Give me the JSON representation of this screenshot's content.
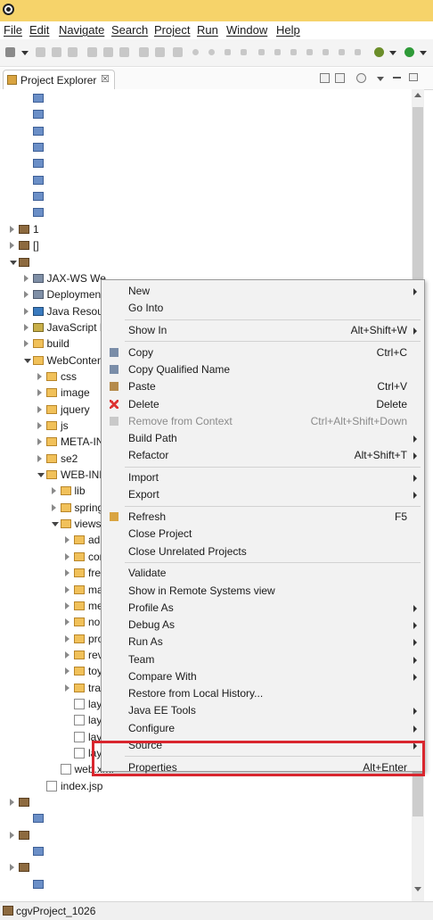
{
  "menubar": {
    "items": [
      "File",
      "Edit",
      "Navigate",
      "Search",
      "Project",
      "Run",
      "Window",
      "Help"
    ]
  },
  "view_tab": {
    "title": "Project Explorer",
    "close": "☒"
  },
  "tree": [
    {
      "depth": 1,
      "icon": "pkg",
      "label": "",
      "tw": "none"
    },
    {
      "depth": 1,
      "icon": "pkg",
      "label": "",
      "tw": "none"
    },
    {
      "depth": 1,
      "icon": "pkg",
      "label": "",
      "tw": "none"
    },
    {
      "depth": 1,
      "icon": "pkg",
      "label": "",
      "tw": "none"
    },
    {
      "depth": 1,
      "icon": "pkg",
      "label": "",
      "tw": "none"
    },
    {
      "depth": 1,
      "icon": "pkg",
      "label": "",
      "tw": "none"
    },
    {
      "depth": 1,
      "icon": "pkg",
      "label": "",
      "tw": "none"
    },
    {
      "depth": 1,
      "icon": "pkg",
      "label": "",
      "tw": "none"
    },
    {
      "depth": 0,
      "icon": "proj",
      "label": "1",
      "tw": "c"
    },
    {
      "depth": 0,
      "icon": "proj",
      "label": "[]",
      "tw": "c"
    },
    {
      "depth": 0,
      "icon": "proj",
      "label": "",
      "tw": "e"
    },
    {
      "depth": 1,
      "icon": "tool",
      "label": "JAX-WS We",
      "tw": "c"
    },
    {
      "depth": 1,
      "icon": "tool",
      "label": "Deploymen",
      "tw": "c"
    },
    {
      "depth": 1,
      "icon": "db",
      "label": "Java Resour",
      "tw": "c"
    },
    {
      "depth": 1,
      "icon": "js",
      "label": "JavaScript R",
      "tw": "c"
    },
    {
      "depth": 1,
      "icon": "fold",
      "label": "build",
      "tw": "c"
    },
    {
      "depth": 1,
      "icon": "fold",
      "label": "WebConten",
      "tw": "e"
    },
    {
      "depth": 2,
      "icon": "fold",
      "label": "css",
      "tw": "c"
    },
    {
      "depth": 2,
      "icon": "fold",
      "label": "image",
      "tw": "c"
    },
    {
      "depth": 2,
      "icon": "fold",
      "label": "jquery",
      "tw": "c"
    },
    {
      "depth": 2,
      "icon": "fold",
      "label": "js",
      "tw": "c"
    },
    {
      "depth": 2,
      "icon": "fold",
      "label": "META-IN",
      "tw": "c"
    },
    {
      "depth": 2,
      "icon": "fold",
      "label": "se2",
      "tw": "c"
    },
    {
      "depth": 2,
      "icon": "fold",
      "label": "WEB-INF",
      "tw": "e"
    },
    {
      "depth": 3,
      "icon": "fold",
      "label": "lib",
      "tw": "c"
    },
    {
      "depth": 3,
      "icon": "fold",
      "label": "spring",
      "tw": "c"
    },
    {
      "depth": 3,
      "icon": "fold",
      "label": "views",
      "tw": "e"
    },
    {
      "depth": 4,
      "icon": "fold",
      "label": "adi",
      "tw": "c"
    },
    {
      "depth": 4,
      "icon": "fold",
      "label": "cor",
      "tw": "c"
    },
    {
      "depth": 4,
      "icon": "fold",
      "label": "fre",
      "tw": "c"
    },
    {
      "depth": 4,
      "icon": "fold",
      "label": "ma",
      "tw": "c"
    },
    {
      "depth": 4,
      "icon": "fold",
      "label": "me",
      "tw": "c"
    },
    {
      "depth": 4,
      "icon": "fold",
      "label": "no",
      "tw": "c"
    },
    {
      "depth": 4,
      "icon": "fold",
      "label": "pro",
      "tw": "c"
    },
    {
      "depth": 4,
      "icon": "fold",
      "label": "rev",
      "tw": "c"
    },
    {
      "depth": 4,
      "icon": "fold",
      "label": "toy",
      "tw": "c"
    },
    {
      "depth": 4,
      "icon": "fold",
      "label": "tra",
      "tw": "c"
    },
    {
      "depth": 4,
      "icon": "file",
      "label": "lay",
      "tw": "none"
    },
    {
      "depth": 4,
      "icon": "file",
      "label": "lay",
      "tw": "none"
    },
    {
      "depth": 4,
      "icon": "file",
      "label": "lay",
      "tw": "none"
    },
    {
      "depth": 4,
      "icon": "file",
      "label": "layouts.xml",
      "tw": "none"
    },
    {
      "depth": 3,
      "icon": "file",
      "label": "web.xml",
      "tw": "none"
    },
    {
      "depth": 2,
      "icon": "file",
      "label": "index.jsp",
      "tw": "none"
    },
    {
      "depth": 0,
      "icon": "proj",
      "label": "",
      "tw": "c"
    },
    {
      "depth": 1,
      "icon": "pkg",
      "label": "",
      "tw": "none"
    },
    {
      "depth": 0,
      "icon": "proj",
      "label": "",
      "tw": "c"
    },
    {
      "depth": 1,
      "icon": "pkg",
      "label": "",
      "tw": "none"
    },
    {
      "depth": 0,
      "icon": "proj",
      "label": "",
      "tw": "c"
    },
    {
      "depth": 1,
      "icon": "pkg",
      "label": "",
      "tw": "none"
    }
  ],
  "context_menu": {
    "items": [
      {
        "type": "item",
        "label": "New",
        "shortcut": "",
        "submenu": true
      },
      {
        "type": "item",
        "label": "Go Into",
        "shortcut": "",
        "submenu": false
      },
      {
        "type": "sep"
      },
      {
        "type": "item",
        "label": "Show In",
        "shortcut": "Alt+Shift+W",
        "submenu": true
      },
      {
        "type": "sep"
      },
      {
        "type": "item",
        "label": "Copy",
        "shortcut": "Ctrl+C",
        "submenu": false,
        "icon": "copy-icon"
      },
      {
        "type": "item",
        "label": "Copy Qualified Name",
        "shortcut": "",
        "submenu": false,
        "icon": "copy-icon"
      },
      {
        "type": "item",
        "label": "Paste",
        "shortcut": "Ctrl+V",
        "submenu": false,
        "icon": "paste-icon"
      },
      {
        "type": "item",
        "label": "Delete",
        "shortcut": "Delete",
        "submenu": false,
        "icon": "delete-icon"
      },
      {
        "type": "item",
        "label": "Remove from Context",
        "shortcut": "Ctrl+Alt+Shift+Down",
        "submenu": false,
        "disabled": true,
        "icon": "remove-icon"
      },
      {
        "type": "item",
        "label": "Build Path",
        "shortcut": "",
        "submenu": true
      },
      {
        "type": "item",
        "label": "Refactor",
        "shortcut": "Alt+Shift+T",
        "submenu": true
      },
      {
        "type": "sep"
      },
      {
        "type": "item",
        "label": "Import",
        "shortcut": "",
        "submenu": true
      },
      {
        "type": "item",
        "label": "Export",
        "shortcut": "",
        "submenu": true
      },
      {
        "type": "sep"
      },
      {
        "type": "item",
        "label": "Refresh",
        "shortcut": "F5",
        "submenu": false,
        "icon": "refresh-icon"
      },
      {
        "type": "item",
        "label": "Close Project",
        "shortcut": "",
        "submenu": false
      },
      {
        "type": "item",
        "label": "Close Unrelated Projects",
        "shortcut": "",
        "submenu": false
      },
      {
        "type": "sep"
      },
      {
        "type": "item",
        "label": "Validate",
        "shortcut": "",
        "submenu": false
      },
      {
        "type": "item",
        "label": "Show in Remote Systems view",
        "shortcut": "",
        "submenu": false
      },
      {
        "type": "item",
        "label": "Profile As",
        "shortcut": "",
        "submenu": true
      },
      {
        "type": "item",
        "label": "Debug As",
        "shortcut": "",
        "submenu": true
      },
      {
        "type": "item",
        "label": "Run As",
        "shortcut": "",
        "submenu": true
      },
      {
        "type": "item",
        "label": "Team",
        "shortcut": "",
        "submenu": true
      },
      {
        "type": "item",
        "label": "Compare With",
        "shortcut": "",
        "submenu": true
      },
      {
        "type": "item",
        "label": "Restore from Local History...",
        "shortcut": "",
        "submenu": false
      },
      {
        "type": "item",
        "label": "Java EE Tools",
        "shortcut": "",
        "submenu": true
      },
      {
        "type": "item",
        "label": "Configure",
        "shortcut": "",
        "submenu": true
      },
      {
        "type": "item",
        "label": "Source",
        "shortcut": "",
        "submenu": true
      },
      {
        "type": "sep"
      },
      {
        "type": "item",
        "label": "Properties",
        "shortcut": "Alt+Enter",
        "submenu": false
      }
    ]
  },
  "statusbar": {
    "text": "cgvProject_1026"
  },
  "colors": {
    "title_bar": "#f6d36a",
    "highlight_box": "#d9262e",
    "menu_bg": "#f2f2f2"
  }
}
